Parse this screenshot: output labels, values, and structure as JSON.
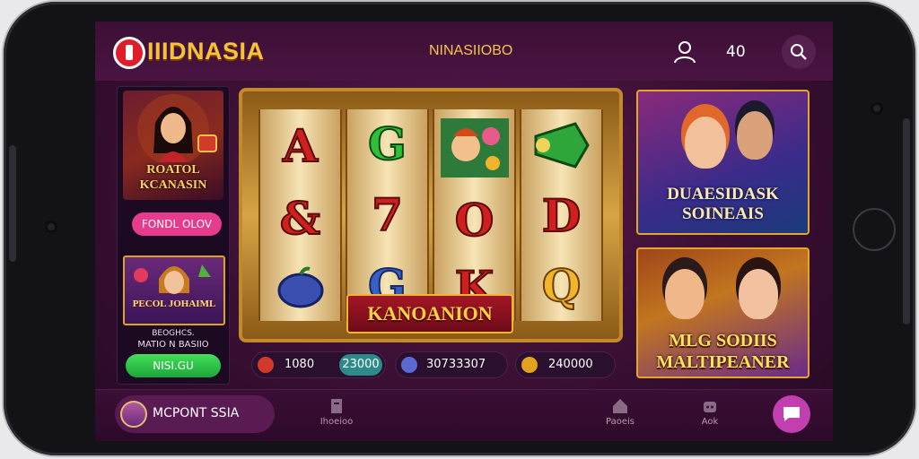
{
  "header": {
    "logo_text": "IIIDNASIA",
    "center_text": "NINASIIOBO",
    "coin_count": "40"
  },
  "left_panel": {
    "featured_title": "ROATOL KCANASIN",
    "follow_label": "FONDL OLOV",
    "promo_title": "PECOL JOHAIML",
    "info_line1": "BEOGHCS.",
    "info_line2": "MATIO N BASIIO",
    "cta_label": "NISI.GU"
  },
  "slot": {
    "reels": [
      [
        "A",
        "&",
        "img-icon"
      ],
      [
        "G",
        "7",
        "G"
      ],
      [
        "img-icon",
        "O",
        "K"
      ],
      [
        "img-icon",
        "D",
        "Q"
      ]
    ],
    "banner": "KANOANION"
  },
  "stats": [
    {
      "value": "1080",
      "value2": "23000"
    },
    {
      "value": "30733307"
    },
    {
      "value": "240000"
    }
  ],
  "right_cards": [
    {
      "title": "DUAESIDASK SOINEAIS"
    },
    {
      "title": "MLG SODIIS MALTIPEANER"
    }
  ],
  "bottom": {
    "profile_name": "MCPONT SSIA",
    "nav": [
      {
        "label": "Ihoeioo",
        "icon": "document-icon"
      },
      {
        "label": "Paoeis",
        "icon": "house-icon"
      },
      {
        "label": "Aok",
        "icon": "bot-icon"
      }
    ]
  },
  "colors": {
    "accent_gold": "#f5c33b",
    "background": "#3a0f33",
    "cta_green": "#2fbf3a",
    "pink": "#e73b8e"
  }
}
